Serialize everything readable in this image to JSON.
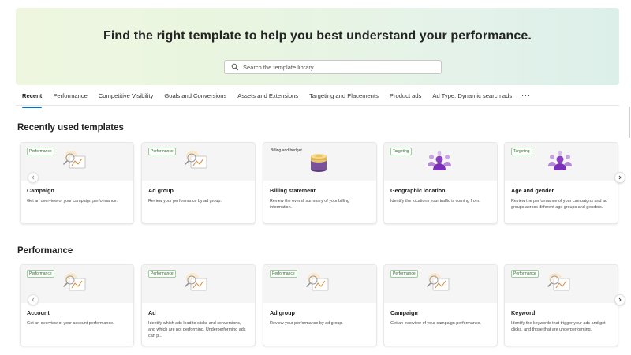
{
  "hero": {
    "title": "Find the right template to help you best understand your performance.",
    "search_placeholder": "Search the template library"
  },
  "tabs": [
    {
      "label": "Recent",
      "active": true
    },
    {
      "label": "Performance"
    },
    {
      "label": "Competitive Visibility"
    },
    {
      "label": "Goals and Conversions"
    },
    {
      "label": "Assets and Extensions"
    },
    {
      "label": "Targeting and Placements"
    },
    {
      "label": "Product ads"
    },
    {
      "label": "Ad Type: Dynamic search ads"
    }
  ],
  "tabs_more": "···",
  "sections": [
    {
      "title": "Recently used templates",
      "cards": [
        {
          "tag": "Performance",
          "title": "Campaign",
          "desc": "Get an overview of your campaign performance.",
          "icon": "chart-magnifier-icon"
        },
        {
          "tag": "Performance",
          "title": "Ad group",
          "desc": "Review your performance by ad group.",
          "icon": "chart-magnifier-icon"
        },
        {
          "tag": "Billing and budget",
          "title": "Billing statement",
          "desc": "Review the overall summary of your billing information.",
          "icon": "coin-stack-icon"
        },
        {
          "tag": "Targeting",
          "title": "Geographic location",
          "desc": "Identify the locations your traffic is coming from.",
          "icon": "audience-icon"
        },
        {
          "tag": "Targeting",
          "title": "Age and gender",
          "desc": "Review the performance of your campaigns and ad groups across different age groups and genders.",
          "icon": "audience-icon"
        }
      ]
    },
    {
      "title": "Performance",
      "cards": [
        {
          "tag": "Performance",
          "title": "Account",
          "desc": "Get an overview of your account performance.",
          "icon": "chart-magnifier-icon"
        },
        {
          "tag": "Performance",
          "title": "Ad",
          "desc": "Identify which ads lead to clicks and conversions, and which are not performing. Underperforming ads can p...",
          "icon": "chart-magnifier-icon"
        },
        {
          "tag": "Performance",
          "title": "Ad group",
          "desc": "Review your performance by ad group.",
          "icon": "chart-magnifier-icon"
        },
        {
          "tag": "Performance",
          "title": "Campaign",
          "desc": "Get an overview of your campaign performance.",
          "icon": "chart-magnifier-icon"
        },
        {
          "tag": "Performance",
          "title": "Keyword",
          "desc": "Identify the keywords that trigger your ads and get clicks, and those that are underperforming.",
          "icon": "chart-magnifier-icon"
        }
      ]
    }
  ],
  "colors": {
    "accent": "#0f6cbd",
    "tag_border": "#9bcf9b",
    "tag_text": "#2e6b2e",
    "hero_start": "#eef6df",
    "hero_end": "#dcefe9"
  }
}
